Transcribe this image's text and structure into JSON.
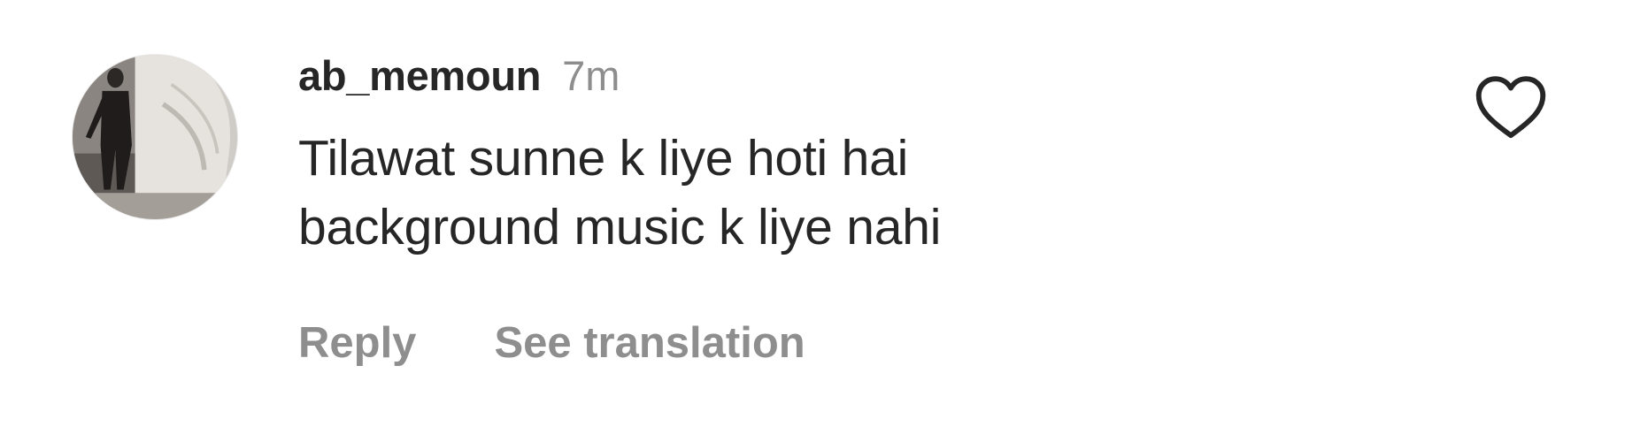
{
  "comment": {
    "avatar_icon": "user-avatar-photo",
    "username": "ab_memoun",
    "timestamp": "7m",
    "text_lines": [
      "Tilawat sunne k liye hoti hai",
      "background music k liye nahi"
    ],
    "actions": {
      "reply_label": "Reply",
      "translate_label": "See translation"
    },
    "like_icon": "heart-outline-icon",
    "colors": {
      "primary_text": "#262626",
      "secondary_text": "#8e8e8e",
      "background": "#ffffff"
    }
  }
}
